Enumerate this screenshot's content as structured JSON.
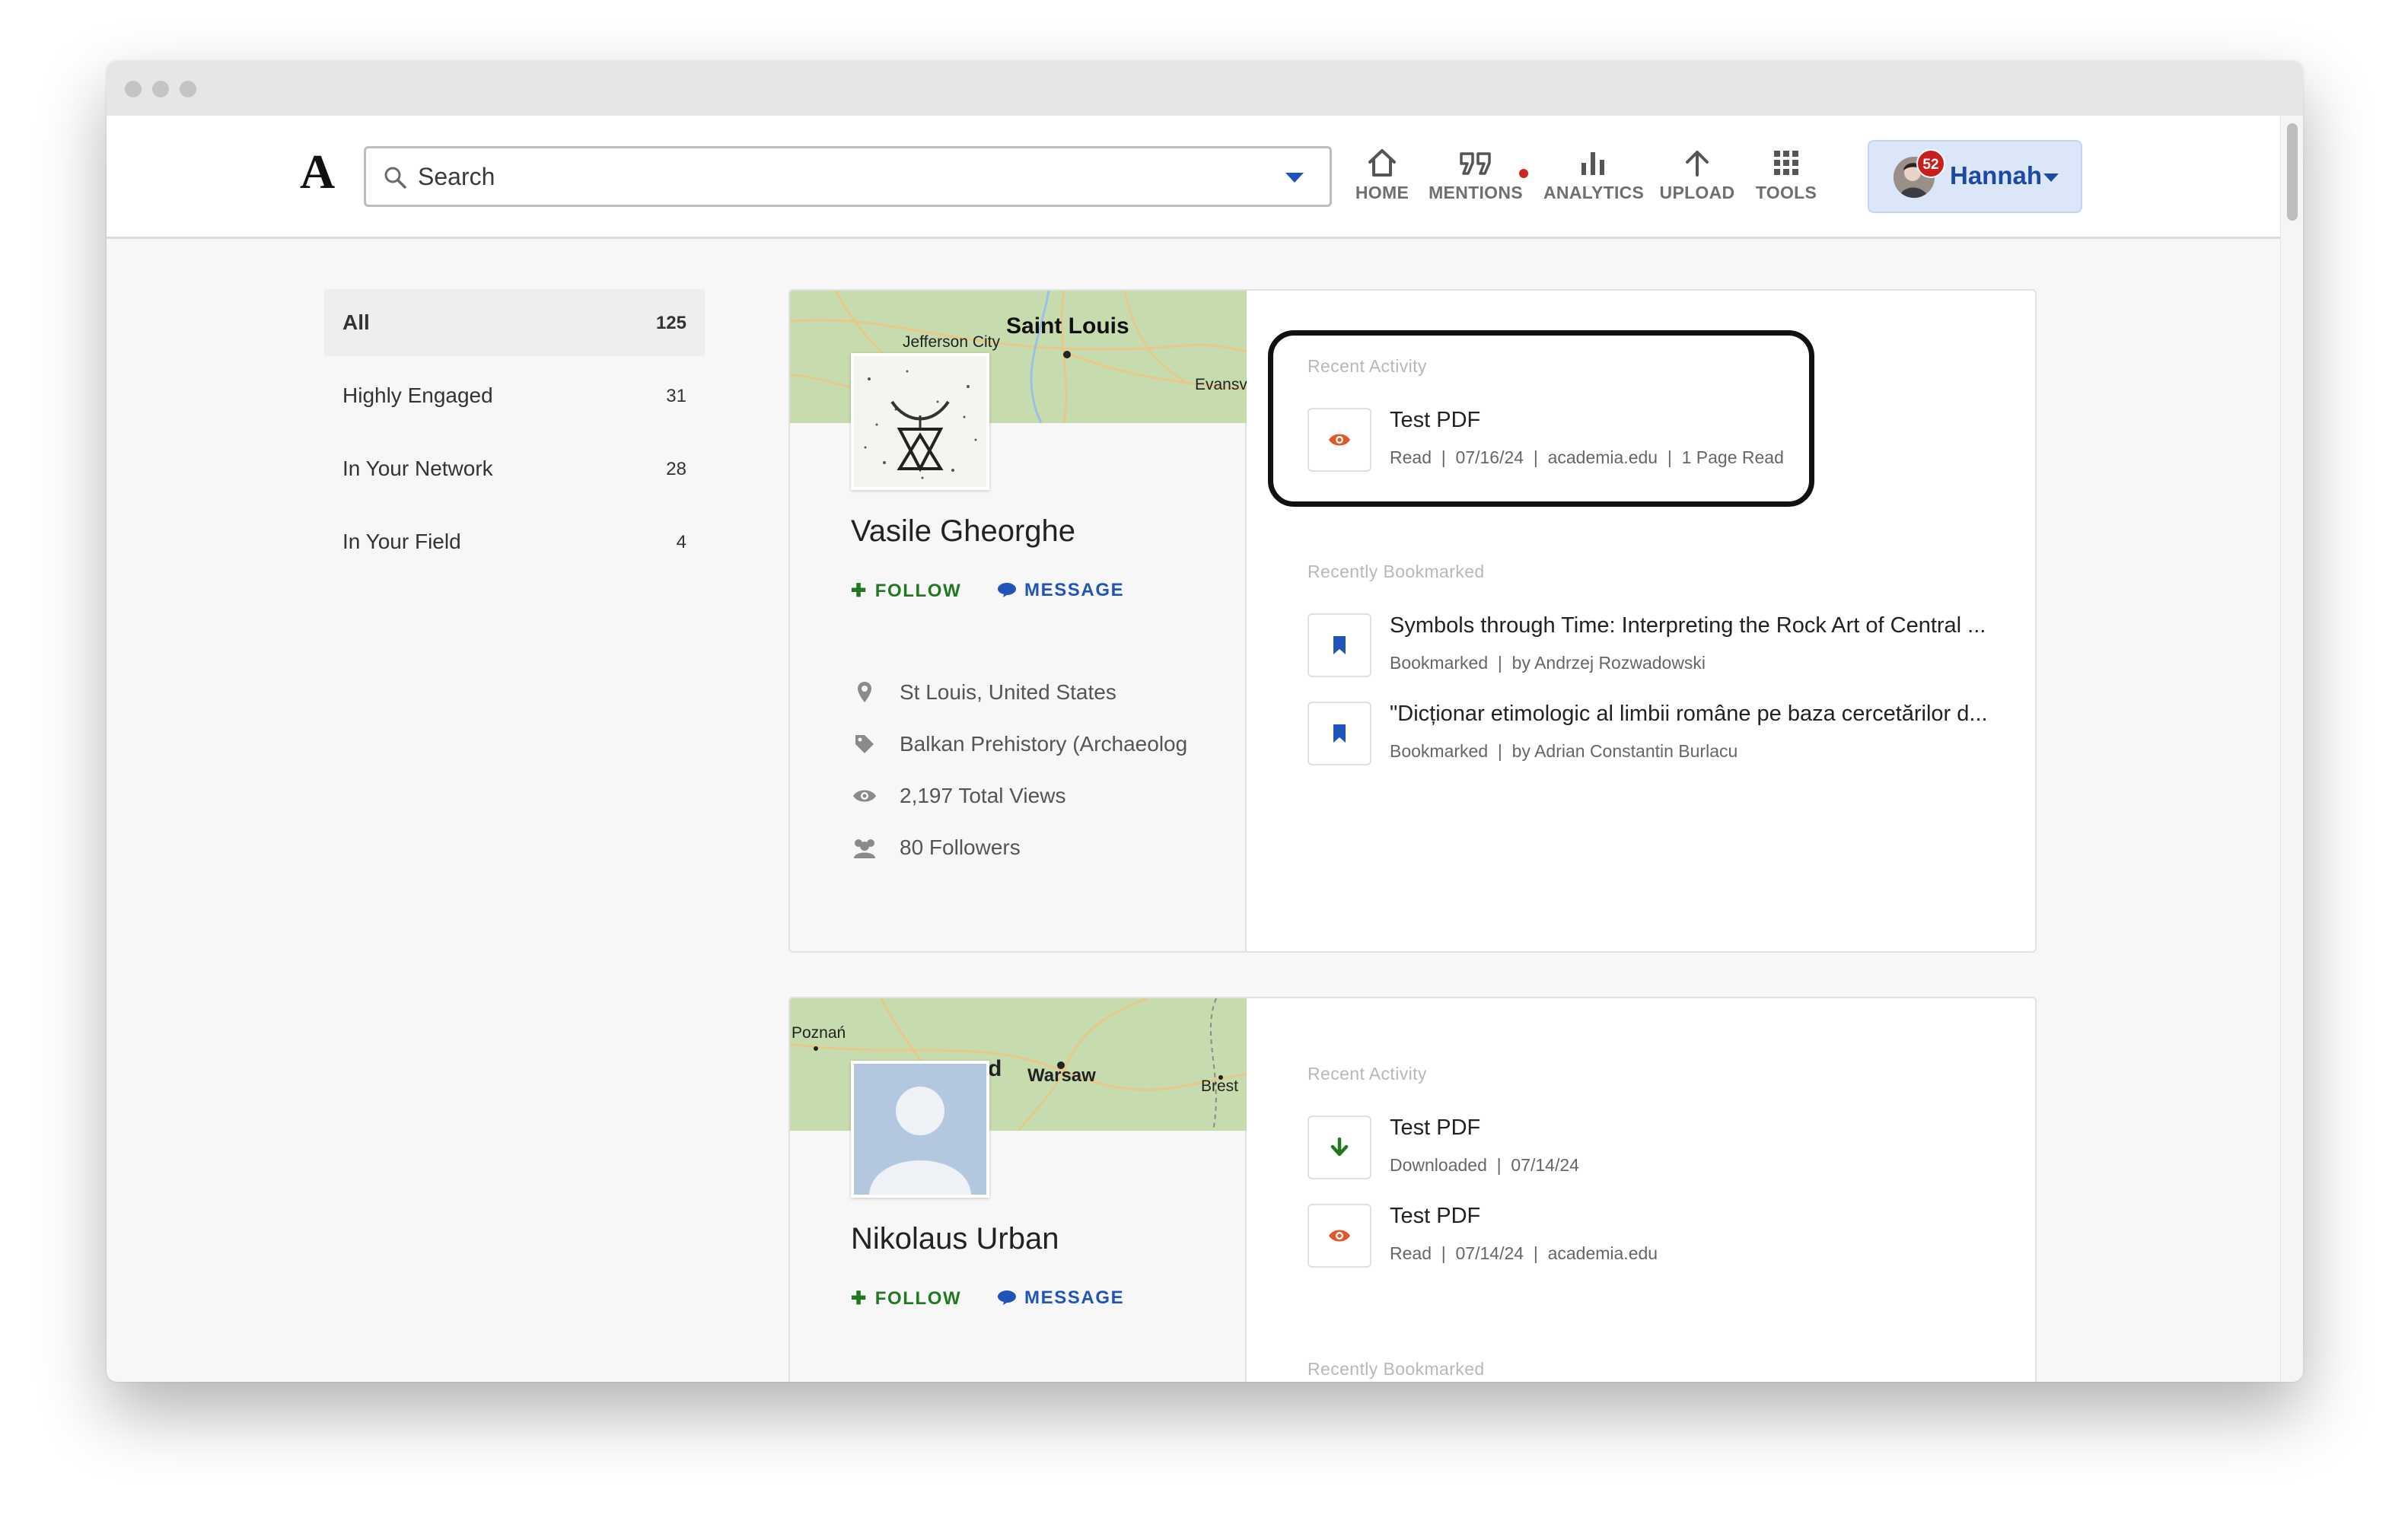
{
  "header": {
    "logo": "A",
    "search_placeholder": "Search",
    "nav": {
      "home": "HOME",
      "mentions": "MENTIONS",
      "analytics": "ANALYTICS",
      "upload": "UPLOAD",
      "tools": "TOOLS"
    },
    "user": {
      "name": "Hannah",
      "badge_count": "52"
    }
  },
  "sidebar": {
    "items": [
      {
        "label": "All",
        "count": "125",
        "active": true
      },
      {
        "label": "Highly Engaged",
        "count": "31"
      },
      {
        "label": "In Your Network",
        "count": "28"
      },
      {
        "label": "In Your Field",
        "count": "4"
      }
    ]
  },
  "cards": [
    {
      "map_labels": {
        "big": "Saint Louis",
        "a": "Jefferson City",
        "b": "Evansvi"
      },
      "name": "Vasile Gheorghe",
      "follow": "FOLLOW",
      "message": "MESSAGE",
      "location": "St Louis, United States",
      "field": "Balkan Prehistory (Archaeolog",
      "views": "2,197 Total Views",
      "followers": "80 Followers",
      "recent_activity_title": "Recent Activity",
      "recent_activity": [
        {
          "icon": "eye-icon",
          "title": "Test PDF",
          "meta": "Read  |  07/16/24  |  academia.edu  |  1 Page Read"
        }
      ],
      "recently_bookmarked_title": "Recently Bookmarked",
      "bookmarks": [
        {
          "title": "Symbols through Time: Interpreting the Rock Art of Central ...",
          "meta": "Bookmarked  |  by Andrzej Rozwadowski"
        },
        {
          "title": "\"Dicționar etimologic al limbii române pe baza cercetărilor d...",
          "meta": "Bookmarked  |  by Adrian Constantin Burlacu"
        }
      ]
    },
    {
      "map_labels": {
        "a": "Poznań",
        "big": "Warsaw",
        "b": "Brest",
        "c": "d"
      },
      "name": "Nikolaus Urban",
      "follow": "FOLLOW",
      "message": "MESSAGE",
      "recent_activity_title": "Recent Activity",
      "recent_activity": [
        {
          "icon": "download-arrow-icon",
          "title": "Test PDF",
          "meta": "Downloaded  |  07/14/24"
        },
        {
          "icon": "eye-icon",
          "title": "Test PDF",
          "meta": "Read  |  07/14/24  |  academia.edu"
        }
      ],
      "recently_bookmarked_title": "Recently Bookmarked"
    }
  ],
  "colors": {
    "follow_green": "#1f7a1f",
    "message_blue": "#1f54b8",
    "user_button_bg": "#dbe6f8",
    "notification_red": "#c71e1e",
    "read_icon_orange": "#e0592a"
  }
}
